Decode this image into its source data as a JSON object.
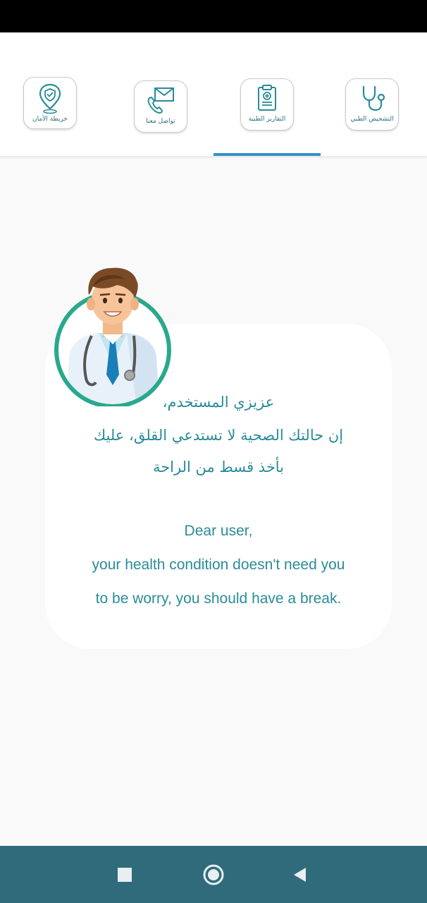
{
  "tabs": [
    {
      "id": "safety",
      "label": "خريطة الأمان",
      "icon": "map-pin-shield-icon"
    },
    {
      "id": "contact",
      "label": "تواصل معنا",
      "icon": "envelope-phone-icon"
    },
    {
      "id": "reports",
      "label": "التقارير الطبية",
      "icon": "medical-clipboard-icon"
    },
    {
      "id": "diagnosis",
      "label": "التشخيص الطبي",
      "icon": "stethoscope-icon"
    }
  ],
  "active_tab": "reports",
  "message": {
    "ar_line1": "عزيزي المستخدم،",
    "ar_line2": "إن حالتك الصحية لا تستدعي القلق، عليك",
    "ar_line3": "بأخذ قسط من الراحة",
    "en_line1": "Dear user,",
    "en_line2": "your health condition doesn't need you",
    "en_line3": "to be worry, you should have a break."
  },
  "colors": {
    "accent_teal": "#2a8c98",
    "indicator_blue": "#3a8fc7",
    "nav_bar": "#306b7b",
    "avatar_ring": "#2aa88e"
  },
  "nav": {
    "recents_icon": "square-icon",
    "home_icon": "circle-icon",
    "back_icon": "triangle-back-icon"
  }
}
